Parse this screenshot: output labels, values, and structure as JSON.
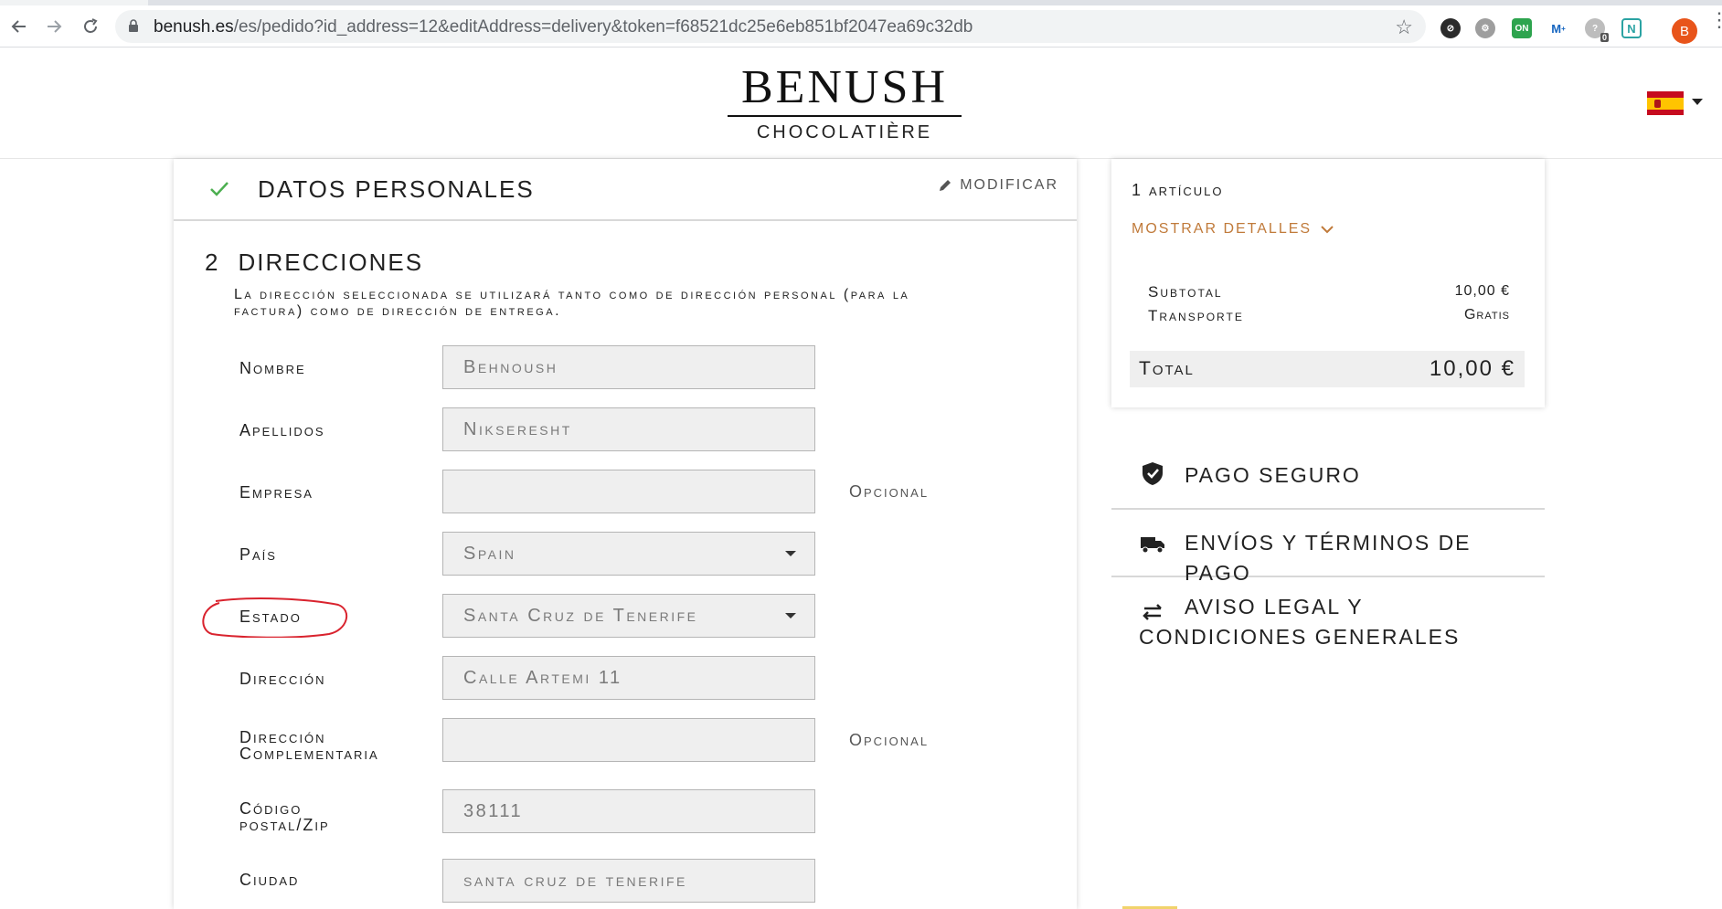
{
  "browser": {
    "url_host": "benush.es",
    "url_path": "/es/pedido?id_address=12&editAddress=delivery&token=f68521dc25e6eb851bf2047ea69c32db",
    "profile_initial": "B",
    "extension_badge": "0",
    "ext_on_label": "ON",
    "ext_n_label": "N"
  },
  "header": {
    "brand": "BENUSH",
    "subtitle": "CHOCOLATIÈRE"
  },
  "checkout": {
    "step1_title": "DATOS PERSONALES",
    "step1_edit": "MODIFICAR",
    "step2_number": "2",
    "step2_title": "DIRECCIONES",
    "step2_description": "La dirección seleccionada se utilizará tanto como de dirección personal (para la factura) como de dirección de entrega.",
    "fields": {
      "nombre": {
        "label": "Nombre",
        "value": "Behnoush"
      },
      "apellidos": {
        "label": "Apellidos",
        "value": "Nikseresht"
      },
      "empresa": {
        "label": "Empresa",
        "value": "",
        "hint": "Opcional"
      },
      "pais": {
        "label": "País",
        "value": "Spain"
      },
      "estado": {
        "label": "Estado",
        "value": "Santa Cruz de Tenerife"
      },
      "direccion": {
        "label": "Dirección",
        "value": "Calle Artemi 11"
      },
      "direccion2": {
        "label_line1": "Dirección",
        "label_line2": "Complementaria",
        "value": "",
        "hint": "Opcional"
      },
      "codigo": {
        "label_line1": "Código",
        "label_line2": "postal/Zip",
        "value": "38111"
      },
      "ciudad": {
        "label": "Ciudad",
        "value": "santa cruz de tenerife"
      }
    }
  },
  "summary": {
    "count": "1 artículo",
    "show_details": "MOSTRAR DETALLES",
    "subtotal_label": "Subtotal",
    "subtotal_value": "10,00 €",
    "shipping_label": "Transporte",
    "shipping_value": "Gratis",
    "total_label": "Total",
    "total_value": "10,00 €"
  },
  "info": {
    "secure": "PAGO SEGURO",
    "shipping": "ENVÍOS Y TÉRMINOS DE PAGO",
    "legal": "AVISO LEGAL Y CONDICIONES GENERALES"
  },
  "colors": {
    "accent": "#c07a3a",
    "check": "#4caf50",
    "annotation": "#d9232e"
  }
}
